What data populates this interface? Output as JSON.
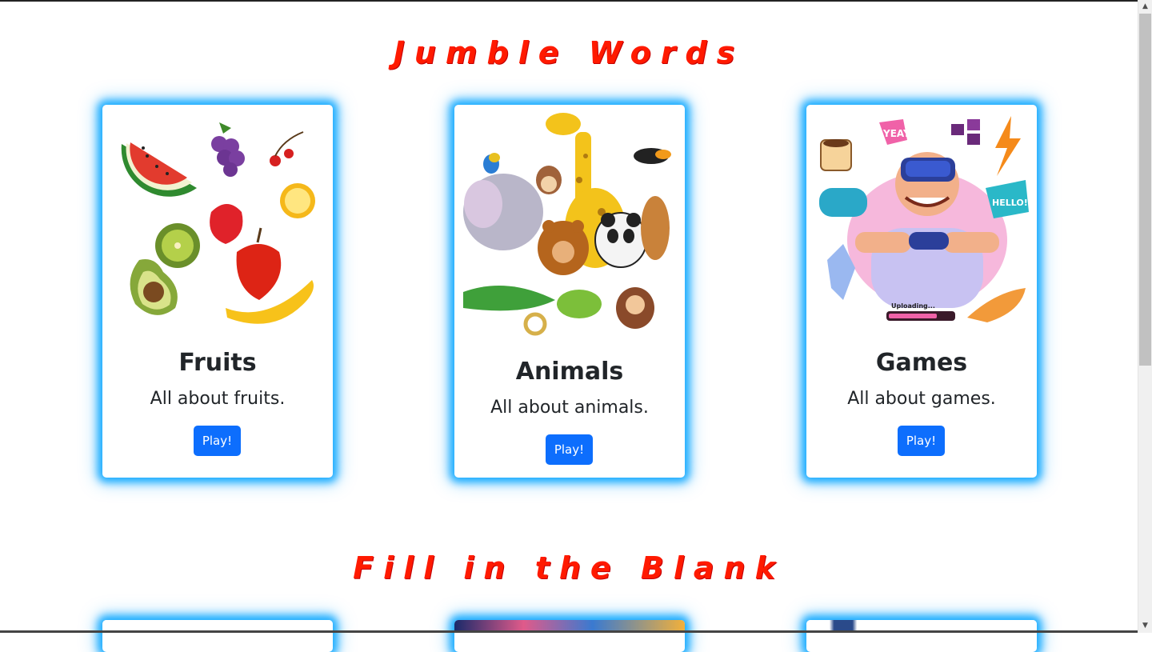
{
  "sections": [
    {
      "title": "Jumble Words",
      "cards": [
        {
          "title": "Fruits",
          "description": "All about fruits.",
          "button": "Play!",
          "image": "fruits-illustration"
        },
        {
          "title": "Animals",
          "description": "All about animals.",
          "button": "Play!",
          "image": "animals-illustration"
        },
        {
          "title": "Games",
          "description": "All about games.",
          "button": "Play!",
          "image": "gamer-illustration"
        }
      ]
    },
    {
      "title": "Fill in the Blank",
      "cards": []
    }
  ],
  "games_art_text": {
    "yeay": "YEAY!",
    "hello": "HELLO!",
    "uploading": "Uploading..."
  },
  "colors": {
    "accent": "#ff1a00",
    "glow": "#00a2ff",
    "button": "#0d6efd"
  }
}
